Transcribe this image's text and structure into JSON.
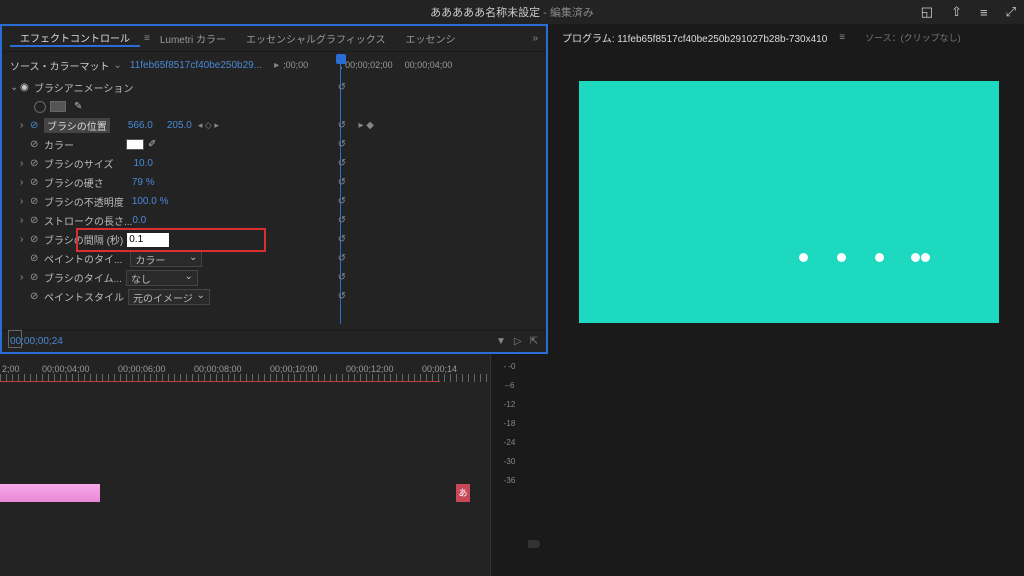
{
  "titlebar": {
    "title": "あああああ名称未設定",
    "suffix": " - 編集済み"
  },
  "left_panel": {
    "tabs": [
      "エフェクトコントロール",
      "Lumetri カラー",
      "エッセンシャルグラフィックス",
      "エッセンシ"
    ],
    "source_prefix": "ソース・カラーマット",
    "source_clip": "11feb65f8517cf40be250b29...",
    "time_labels": [
      ";00;00",
      ";    00;00;02;00",
      "00;00;04;00"
    ],
    "effect_name": "ブラシアニメーション",
    "props": [
      {
        "name": "ブラシの位置",
        "v1": "566.0",
        "v2": "205.0",
        "highlight": true,
        "keyframe": true
      },
      {
        "name": "カラー",
        "type": "color"
      },
      {
        "name": "ブラシのサイズ",
        "value": "10.0"
      },
      {
        "name": "ブラシの硬さ",
        "value": "79 %"
      },
      {
        "name": "ブラシの不透明度",
        "value": "100.0 %"
      },
      {
        "name": "ストロークの長さ...",
        "value": "0.0"
      },
      {
        "name": "ブラシの間隔 (秒)",
        "value": "0.1",
        "input": true
      },
      {
        "name": "ペイントのタイ...",
        "value": "カラー",
        "dropdown": true
      },
      {
        "name": "ブラシのタイム...",
        "value": "なし",
        "dropdown": true
      },
      {
        "name": "ペイントスタイル",
        "value": "元のイメージ",
        "dropdown": true
      }
    ],
    "timecode": "00;00;00;24"
  },
  "right_panel": {
    "program_label": "プログラム:",
    "program_name": "11feb65f8517cf40be250b291027b28b-730x410",
    "source_label": "ソース：(クリップなし)"
  },
  "timeline": {
    "times": [
      "2;00",
      "00;00;04;00",
      "00;00;06;00",
      "00;00;08;00",
      "00;00;10;00",
      "00;00;12;00",
      "00;00;14"
    ],
    "clip_label": "あ"
  },
  "audio_meter": {
    "levels": [
      "- -0",
      "--6",
      "-12",
      "-18",
      "-24",
      "-30",
      "-36"
    ]
  }
}
